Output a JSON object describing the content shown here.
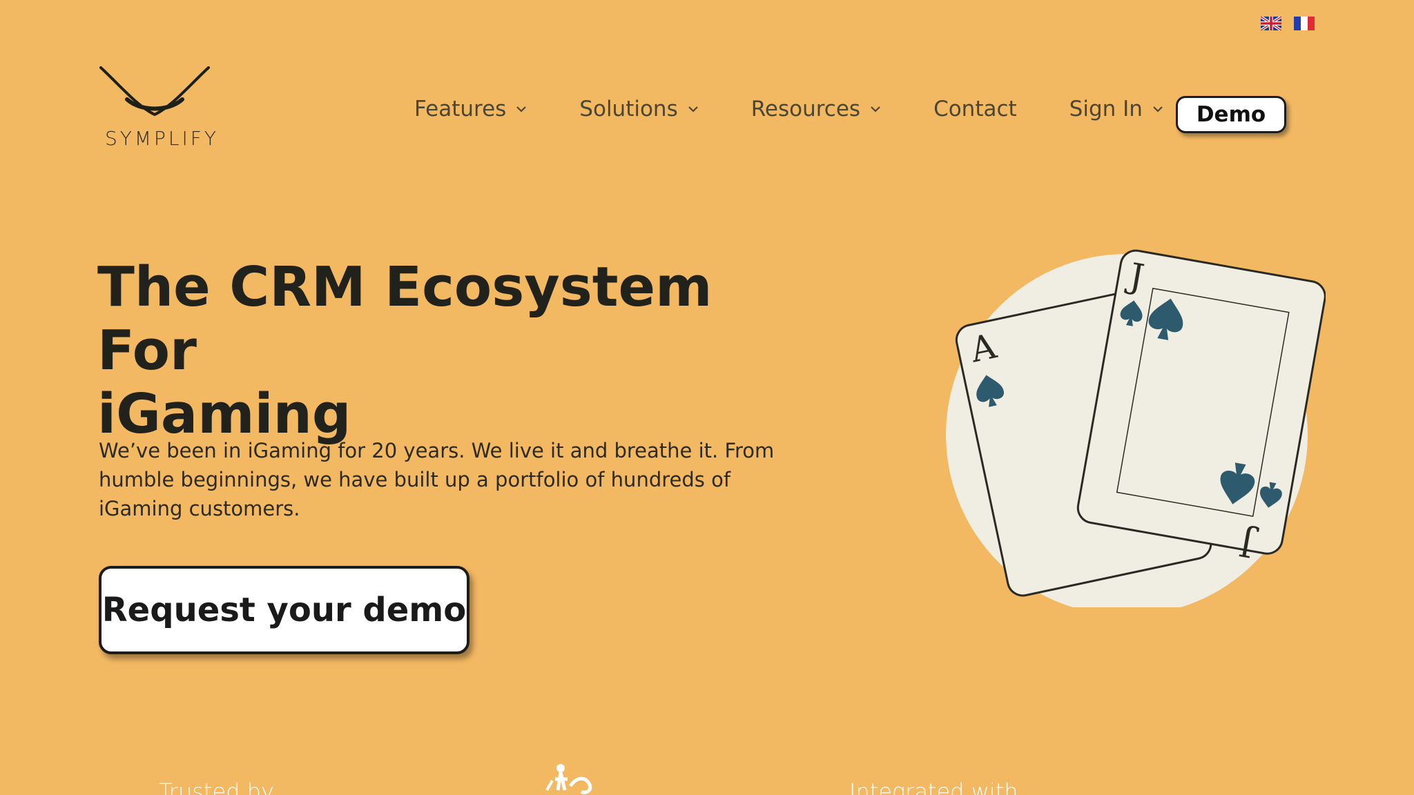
{
  "languages": [
    {
      "code": "en",
      "icon": "uk-flag-icon"
    },
    {
      "code": "fr",
      "icon": "france-flag-icon"
    }
  ],
  "logo": {
    "text": "SYMPLIFY"
  },
  "nav": {
    "features": "Features",
    "solutions": "Solutions",
    "resources": "Resources",
    "contact": "Contact",
    "sign_in": "Sign In",
    "demo": "Demo"
  },
  "hero": {
    "title_line1": "The CRM Ecosystem For",
    "title_line2": "iGaming",
    "text": "We’ve been in iGaming for 20 years. We live it and breathe it. From humble beginnings, we have built up a portfolio of hundreds of iGaming customers.",
    "cta": "Request your demo"
  },
  "illustration": {
    "cards": [
      "A",
      "J"
    ],
    "suit": "spade-icon"
  },
  "bottom": {
    "trusted_by": "Trusted by",
    "integrated_with": "Integrated with"
  },
  "colors": {
    "background": "#F2B862",
    "text": "#22221C",
    "circle": "#F0EDE3",
    "spade": "#2E5A6E"
  }
}
